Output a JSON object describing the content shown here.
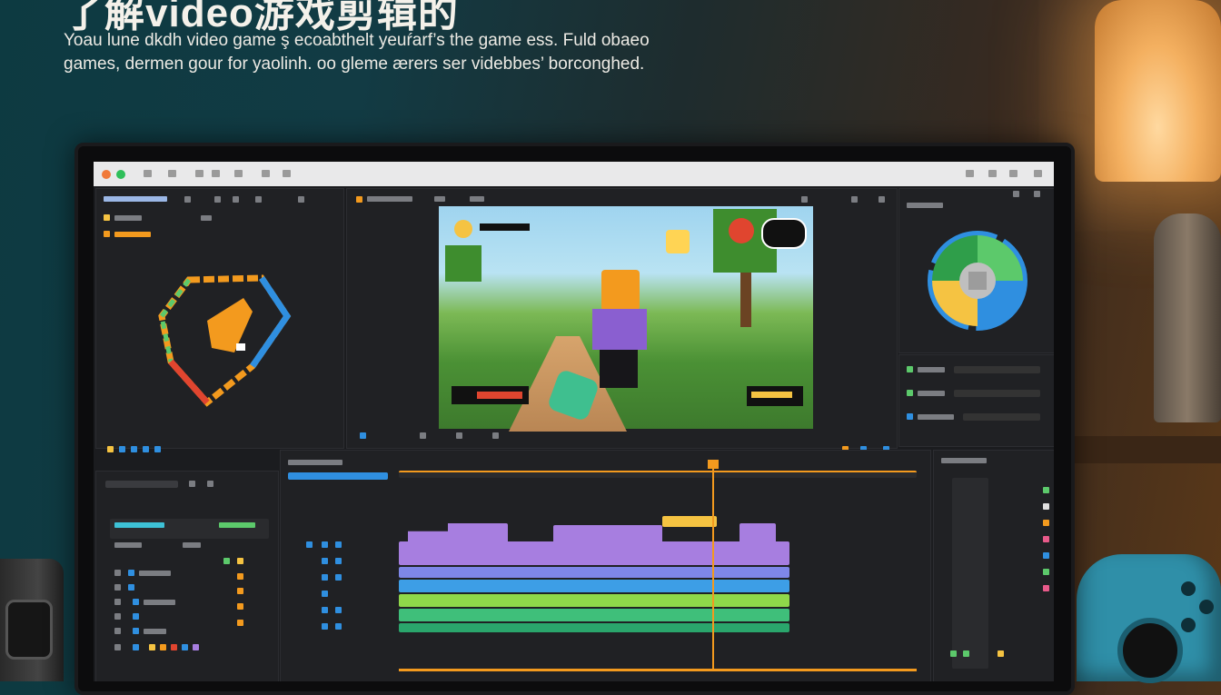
{
  "headline": "了解video游戏剪辑的",
  "subtitle": {
    "line1": "Yoau lune dkdh  video game ş ecoabthelt yeuŕarf’s the game ess. Fuld obaeo",
    "line2": "games,  dermen gour for yaolinh. oo gleme ærers  ser videbbes’ borconghed."
  },
  "colors": {
    "orange": "#f39a1e",
    "blue": "#2f8fe0",
    "purple": "#a77ee0",
    "green": "#5cc96b",
    "cyan": "#3dc1d6",
    "yellow": "#f5c342"
  },
  "editor": {
    "window_title": "",
    "panels": [
      "project-bin",
      "program-monitor",
      "color-wheel",
      "inspector",
      "timeline",
      "audio-meters"
    ]
  },
  "timeline": {
    "tracks": [
      "video-1",
      "video-2",
      "video-3",
      "audio-1",
      "audio-2"
    ],
    "playhead_fraction": 0.6
  }
}
